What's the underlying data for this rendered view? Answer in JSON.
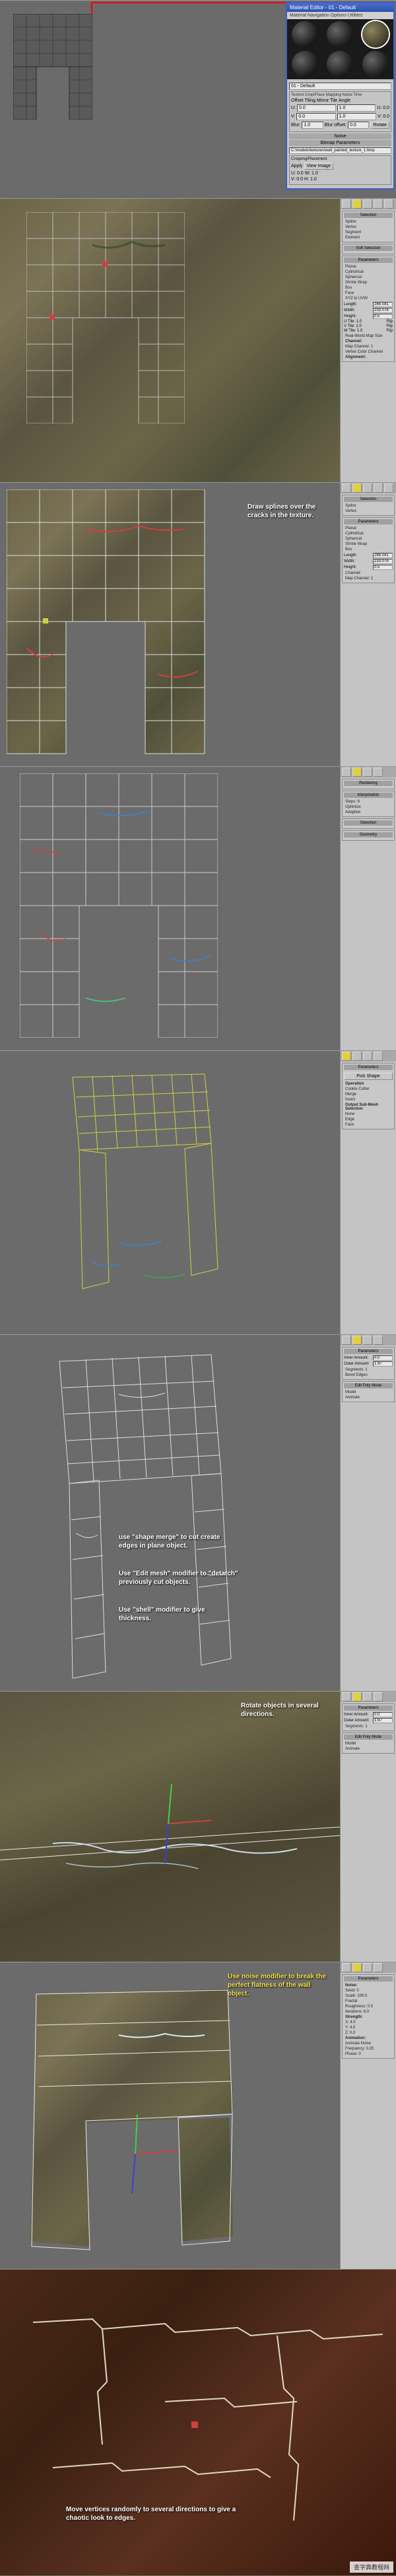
{
  "material_editor": {
    "title": "Material Editor - 01 - Default",
    "menu": "Material  Navigation  Options  Utilities",
    "name_field": "01 - Default",
    "tabs": "Texture  Crop/Place  Mapping  Noise  Time",
    "offset_label": "Offset",
    "tiling_label": "Tiling",
    "u_label": "U:",
    "v_label": "V:",
    "u_offset": "0.0",
    "v_offset": "0.0",
    "u_tiling": "1.0",
    "v_tiling": "1.0",
    "mirror_label": "Mirror  Tile",
    "angle_label": "Angle",
    "uvw_u": "U: 0.0",
    "uvw_v": "V: 0.0",
    "uvw_w": "W: 0.0",
    "rotate_btn": "Rotate",
    "blur_label": "Blur:",
    "blur_val": "1.0",
    "blur_offset_label": "Blur offset:",
    "blur_offset_val": "0.0",
    "noise_header": "Noise",
    "bitmap_header": "Bitmap Parameters",
    "bitmap_path": "C:\\models\\textures\\wall_painted_texture_1.bmp",
    "crop_header": "Cropping/Placement",
    "apply_label": "Apply",
    "view_btn": "View Image",
    "crop_u": "U: 0.0",
    "crop_v": "V: 0.0",
    "crop_w": "W: 1.0",
    "crop_h": "H: 1.0"
  },
  "side_panels": {
    "panel2": {
      "title1": "Selection",
      "items1": [
        "Spline",
        "Vertex",
        "Segment",
        "Element"
      ],
      "title2": "Soft Selection",
      "title3": "Parameters",
      "radio_items": [
        "Planar",
        "Cylindrical",
        "Spherical",
        "Shrink Wrap",
        "Box",
        "Face",
        "XYZ to UVW"
      ],
      "length_label": "Length:",
      "width_label": "Width:",
      "height_label": "Height:",
      "length": "286.041",
      "width": "233.076",
      "height": "0.5",
      "utile": "U Tile: 1.0",
      "vtile": "V Tile: 1.0",
      "wtile": "W Tile: 1.0",
      "flip_label": "Flip",
      "realworld": "Real-World Map Size",
      "channel_title": "Channel:",
      "map_channel": "Map Channel: 1",
      "vertex_color": "Vertex Color Channel",
      "alignment_title": "Alignment:"
    },
    "panel4": {
      "selection_title": "Selection",
      "geom_title": "Geometry",
      "rendering": "Rendering",
      "interpolation": "Interpolation",
      "steps": "Steps: 6",
      "optimize": "Optimize",
      "adaptive": "Adaptive"
    },
    "panel5": {
      "title": "Parameters",
      "pick_shape": "Pick Shape",
      "operation": "Operation",
      "cookie": "Cookie Cutter",
      "merge": "Merge",
      "invert": "Invert",
      "output": "Output Sub-Mesh Selection",
      "none": "None",
      "edge": "Edge",
      "face": "Face"
    },
    "panel6": {
      "title": "Parameters",
      "inner": "Inner Amount:",
      "outer": "Outer Amount:",
      "inner_val": "0.0",
      "outer_val": "1.97",
      "segments": "Segments: 1",
      "bevel_edges": "Bevel Edges",
      "edit_poly": "Edit Poly Mode",
      "model": "Model",
      "animate": "Animate"
    },
    "panel8": {
      "title": "Parameters",
      "noise_group": "Noise:",
      "seed": "Seed: 0",
      "scale": "Scale: 100.0",
      "fractal": "Fractal",
      "roughness": "Roughness: 0.0",
      "iterations": "Iterations: 6.0",
      "strength_group": "Strength:",
      "x_val": "X: 4.0",
      "y_val": "Y: 4.0",
      "z_val": "Z: 0.0",
      "animation_group": "Animation:",
      "animate_noise": "Animate Noise",
      "frequency": "Frequency: 0.25",
      "phase": "Phase: 0"
    }
  },
  "annotations": {
    "a3": "Draw splines over the cracks in the texture.",
    "a6a": "use \"shape merge\" to cut create edges in plane object.",
    "a6b": "Use \"Edit mesh\" modifier to \"detatch\" previously cut objects.",
    "a6c": "Use \"shell\" modifier to give thickness.",
    "a7": "Rotate objects in several directions.",
    "a8": "Use noise modifier to break the perfect flatness of the wall object.",
    "a9": "Move vertices randomly to several directions to give a chaotic look to edges."
  },
  "watermark": "查字典教程网"
}
